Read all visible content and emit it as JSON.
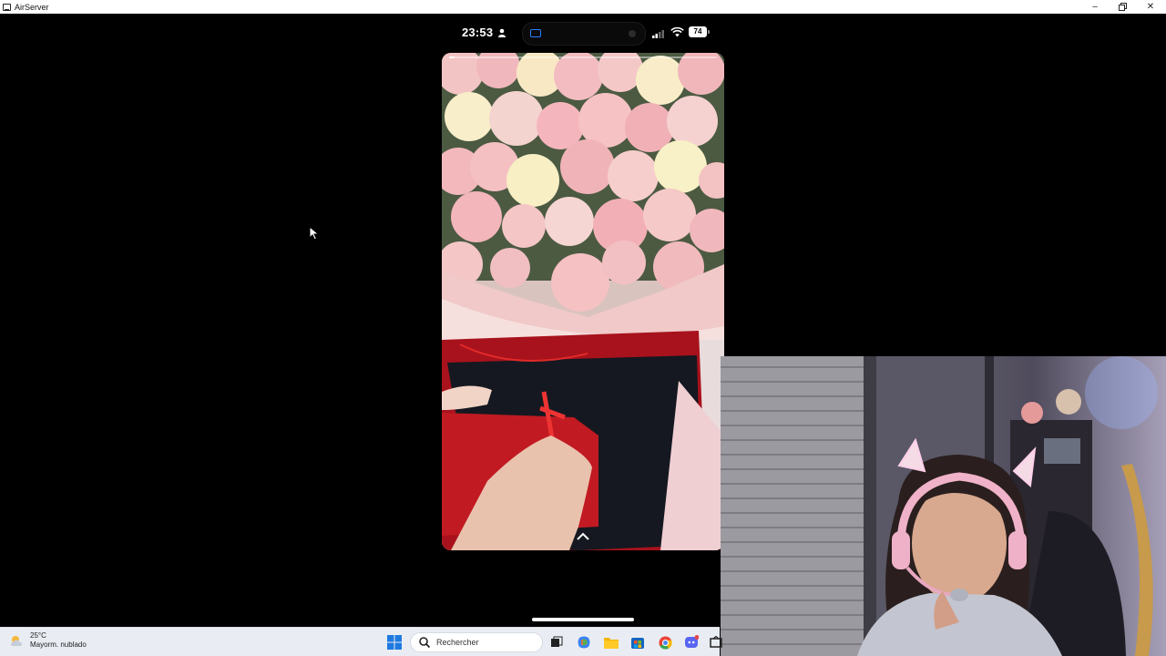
{
  "window": {
    "title": "AirServer",
    "controls": {
      "minimize_icon": "minimize-icon",
      "maximize_icon": "restore-icon",
      "close_icon": "close-icon"
    }
  },
  "phone": {
    "status": {
      "time": "23:53",
      "battery": "74"
    },
    "story": {
      "progress": 0.02
    }
  },
  "taskbar": {
    "weather": {
      "temperature": "25°C",
      "condition": "Mayorm. nublado"
    },
    "search": {
      "placeholder": "Rechercher"
    },
    "icons": [
      "windows-start-icon",
      "search-icon",
      "task-view-icon",
      "copilot-icon",
      "file-explorer-icon",
      "store-icon",
      "chrome-icon",
      "discord-icon",
      "app-icon"
    ]
  },
  "colors": {
    "accent_blue": "#2a7cff",
    "gift_red": "#b8121c",
    "rose_pink": "#f2b8bd"
  }
}
